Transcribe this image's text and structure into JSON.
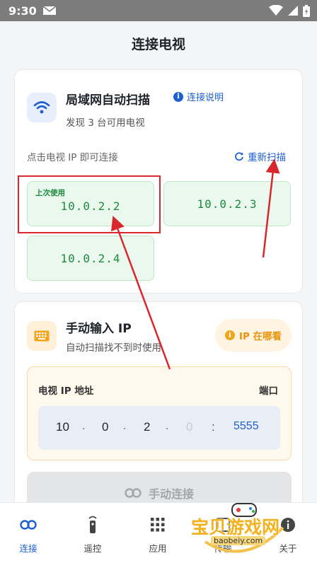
{
  "status_bar": {
    "time": "9:30"
  },
  "page_title": "连接电视",
  "lan_card": {
    "title": "局域网自动扫描",
    "subtitle": "发现 3 台可用电视",
    "help_label": "连接说明",
    "hint": "点击电视 IP 即可连接",
    "rescan_label": "重新扫描",
    "devices": [
      {
        "ip": "10.0.2.2",
        "badge": "上次使用"
      },
      {
        "ip": "10.0.2.3",
        "badge": ""
      },
      {
        "ip": "10.0.2.4",
        "badge": ""
      }
    ]
  },
  "manual_card": {
    "title": "手动输入 IP",
    "subtitle": "自动扫描找不到时使用",
    "where_ip_label": "IP 在哪看",
    "ip_label": "电视 IP 地址",
    "port_label": "端口",
    "ip_octets": [
      "10",
      "0",
      "2",
      "0"
    ],
    "port": "5555",
    "connect_label": "手动连接"
  },
  "bottom_nav": {
    "items": [
      {
        "label": "连接",
        "icon": "link-icon",
        "active": true
      },
      {
        "label": "遥控",
        "icon": "remote-icon",
        "active": false
      },
      {
        "label": "应用",
        "icon": "apps-grid-icon",
        "active": false
      },
      {
        "label": "传输",
        "icon": "transfer-icon",
        "active": false
      },
      {
        "label": "关于",
        "icon": "about-icon",
        "active": false
      }
    ]
  },
  "watermark": {
    "text": "宝贝游戏网",
    "url": "baobeiy.com"
  },
  "colors": {
    "accent": "#1e5fd1",
    "success": "#1e8a3e",
    "warning": "#e9940e",
    "annotation": "#d9272e"
  }
}
